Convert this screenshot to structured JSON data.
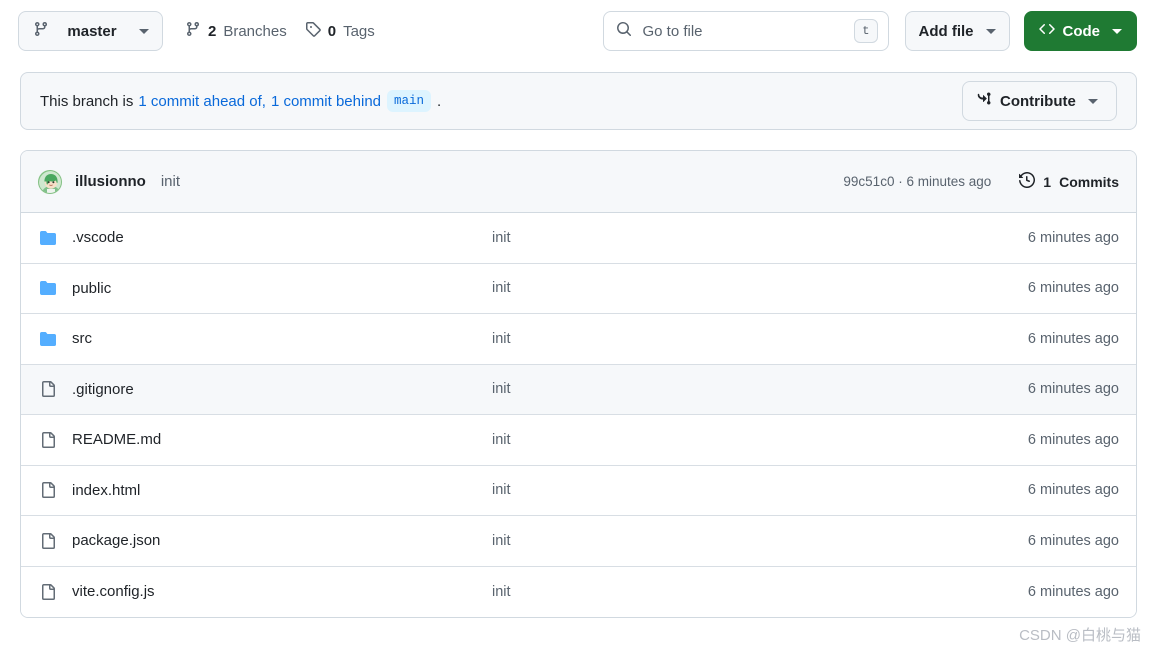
{
  "toolbar": {
    "branch_selector": {
      "icon": "git-branch-icon",
      "label": "master"
    },
    "branches": {
      "icon": "git-branch-icon",
      "count": "2",
      "label": "Branches"
    },
    "tags": {
      "icon": "tag-icon",
      "count": "0",
      "label": "Tags"
    },
    "search": {
      "icon": "search-icon",
      "placeholder": "Go to file",
      "value": "",
      "shortcut": "t"
    },
    "add_file": {
      "label": "Add file"
    },
    "code": {
      "icon": "code-icon",
      "label": "Code",
      "color": "#1f7a33"
    }
  },
  "notice": {
    "lead": "This branch is",
    "ahead": "1 commit ahead of,",
    "behind": "1 commit behind",
    "base_branch": "main",
    "period": ".",
    "contribute": {
      "icon": "git-pull-request-icon",
      "label": "Contribute"
    },
    "link_color": "#0969da",
    "badge_bg": "#ddf4ff"
  },
  "commit_header": {
    "avatar": "user-avatar",
    "author": "illusionno",
    "message": "init",
    "sha": "99c51c0",
    "sha_separator": "·",
    "relative_time": "6 minutes ago",
    "history_icon": "history-icon",
    "commits_count": "1",
    "commits_label": "Commits"
  },
  "files": [
    {
      "type": "folder",
      "icon": "folder-icon",
      "name": ".vscode",
      "message": "init",
      "time": "6 minutes ago",
      "hovered": false
    },
    {
      "type": "folder",
      "icon": "folder-icon",
      "name": "public",
      "message": "init",
      "time": "6 minutes ago",
      "hovered": false
    },
    {
      "type": "folder",
      "icon": "folder-icon",
      "name": "src",
      "message": "init",
      "time": "6 minutes ago",
      "hovered": false
    },
    {
      "type": "file",
      "icon": "file-icon",
      "name": ".gitignore",
      "message": "init",
      "time": "6 minutes ago",
      "hovered": true
    },
    {
      "type": "file",
      "icon": "file-icon",
      "name": "README.md",
      "message": "init",
      "time": "6 minutes ago",
      "hovered": false
    },
    {
      "type": "file",
      "icon": "file-icon",
      "name": "index.html",
      "message": "init",
      "time": "6 minutes ago",
      "hovered": false
    },
    {
      "type": "file",
      "icon": "file-icon",
      "name": "package.json",
      "message": "init",
      "time": "6 minutes ago",
      "hovered": false
    },
    {
      "type": "file",
      "icon": "file-icon",
      "name": "vite.config.js",
      "message": "init",
      "time": "6 minutes ago",
      "hovered": false
    }
  ],
  "watermark": {
    "text": "CSDN @白桃与猫"
  },
  "colors": {
    "folder_blue": "#54aeff",
    "file_gray": "#636c76",
    "border": "#d1d9e0",
    "subtle_bg": "#f6f8fa",
    "text": "#1f2328",
    "muted": "#59636e"
  }
}
